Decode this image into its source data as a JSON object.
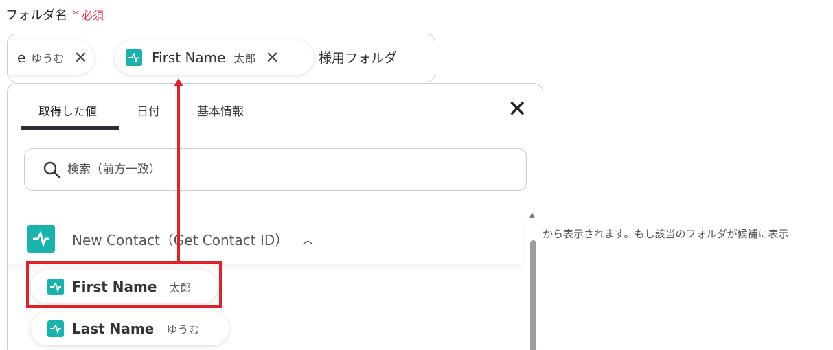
{
  "field": {
    "label": "フォルダ名",
    "required_mark": "*",
    "required_text": "必須"
  },
  "tokens": [
    {
      "name": "e",
      "value": "ゆうむ"
    },
    {
      "name": "First Name",
      "value": "太郎"
    }
  ],
  "token_trailing_text": "様用フォルダ",
  "side_help_text": "から表示されます。もし該当のフォルダが候補に表示",
  "dropdown": {
    "tabs": [
      {
        "label": "取得した値",
        "active": true
      },
      {
        "label": "日付",
        "active": false
      },
      {
        "label": "基本情報",
        "active": false
      }
    ],
    "close_icon": "close-icon",
    "search_placeholder": "検索（前方一致）",
    "group": {
      "title": "New Contact（Get Contact ID）",
      "expanded": true,
      "items": [
        {
          "name": "First Name",
          "value": "太郎"
        },
        {
          "name": "Last Name",
          "value": "ゆうむ"
        }
      ]
    }
  },
  "annotation": {
    "color": "#e0212b",
    "highlighted_item": "First Name"
  },
  "colors": {
    "accent": "#19b3ad",
    "required": "#e0364b"
  }
}
